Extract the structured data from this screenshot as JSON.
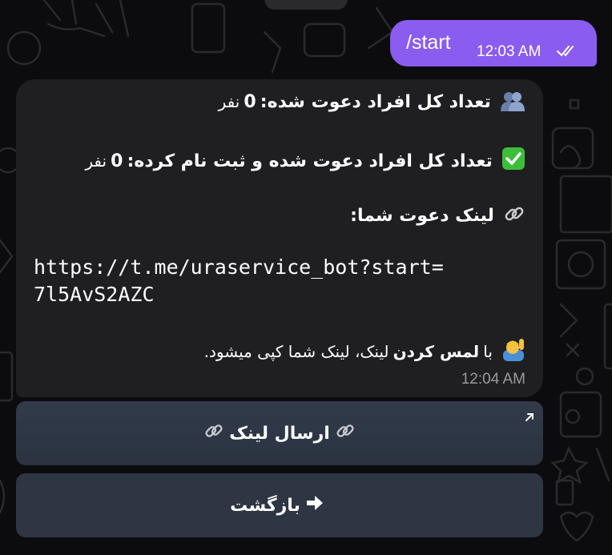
{
  "outgoing": {
    "text": "/start",
    "time": "12:03 AM"
  },
  "incoming": {
    "line1_label": "تعداد کل افراد دعوت شده:",
    "line1_value": "0",
    "line1_unit": "نفر",
    "line2_label": "تعداد کل افراد دعوت شده و ثبت نام کرده:",
    "line2_value": "0",
    "line2_unit": "نفر",
    "line3_label": "لینک دعوت شما:",
    "url_line1": "https://t.me/uraservice_bot?start=",
    "url_line2": "7l5AvS2AZC",
    "hint_prefix": "با",
    "hint_bold": "لمس کردن",
    "hint_rest": "لینک، لینک شما کپی میشود.",
    "time": "12:04 AM"
  },
  "keyboard": {
    "send_link": "ارسال لینک",
    "back": "بازگشت"
  },
  "colors": {
    "background": "#0c0c0e",
    "outgoing_bubble": "#8b5cf0",
    "incoming_bubble": "#1f1f21",
    "keyboard_button": "#2e3644"
  },
  "icons": [
    "people-icon",
    "check-mark-icon",
    "link-icon",
    "raising-hand-icon",
    "right-arrow-icon",
    "expand-arrow-icon",
    "double-check-icon"
  ]
}
